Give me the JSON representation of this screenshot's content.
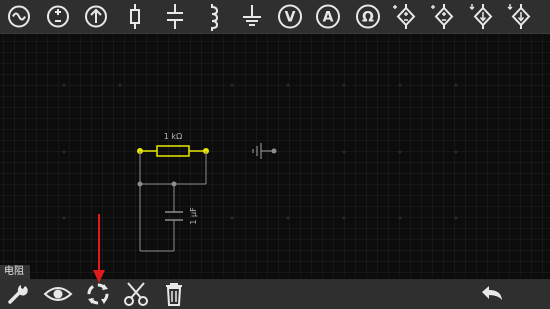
{
  "toolbar": {
    "tools": [
      {
        "icon": "ac-source-icon"
      },
      {
        "icon": "dc-source-icon"
      },
      {
        "icon": "current-source-icon"
      },
      {
        "icon": "resistor-icon"
      },
      {
        "icon": "capacitor-icon"
      },
      {
        "icon": "inductor-icon"
      },
      {
        "icon": "ground-icon"
      },
      {
        "icon": "voltmeter-icon"
      },
      {
        "icon": "ammeter-icon"
      },
      {
        "icon": "ohmmeter-icon"
      },
      {
        "icon": "dependent-voltage-source-icon"
      },
      {
        "icon": "dependent-voltage-source-icon"
      },
      {
        "icon": "dependent-current-source-icon"
      },
      {
        "icon": "dependent-current-source-icon"
      }
    ],
    "meter_letters": {
      "voltmeter": "V",
      "ammeter": "A",
      "ohmmeter": "Ω"
    }
  },
  "circuit": {
    "resistor_label": "1 kΩ",
    "capacitor_label": "1 μF",
    "selected_color": "#e8e800",
    "wire_color": "#8c8c8c"
  },
  "selected_component": "电阻",
  "bottombar": {
    "actions": [
      "wrench-icon",
      "eye-icon",
      "rotate-icon",
      "scissors-icon",
      "trash-icon",
      "undo-icon"
    ]
  },
  "colors": {
    "toolbar_bg": "#2f2f2f",
    "canvas_bg": "#0c0c0c",
    "annotation_arrow": "#e11b1b",
    "icon": "#e8e8e8"
  }
}
